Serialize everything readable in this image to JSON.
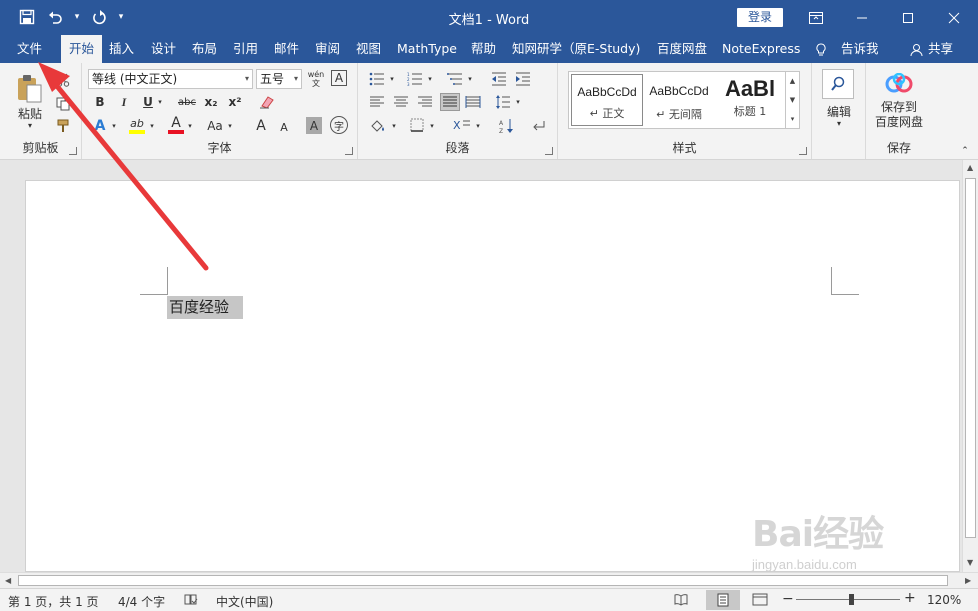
{
  "titlebar": {
    "title": "文档1  -  Word",
    "login_label": "登录",
    "bg_color": "#2b579a"
  },
  "ribbon_tabs": {
    "file": "文件",
    "home": "开始",
    "insert": "插入",
    "design": "设计",
    "layout": "布局",
    "references": "引用",
    "mailings": "邮件",
    "review": "审阅",
    "view": "视图",
    "mathtype": "MathType",
    "help": "帮助",
    "cnki": "知网研学（原E-Study)",
    "baidu_pan": "百度网盘",
    "noteexpress": "NoteExpress",
    "tell_me": "告诉我",
    "share": "共享",
    "active": "开始"
  },
  "clipboard": {
    "paste_label": "粘贴",
    "group_label": "剪贴板"
  },
  "font": {
    "font_name": "等线 (中文正文)",
    "font_size": "五号",
    "wen_glyph": "wén\n文",
    "border_a": "A",
    "bold": "B",
    "italic": "I",
    "underline": "U",
    "strike": "abc",
    "subscript": "x₂",
    "superscript": "x²",
    "text_effect": "A",
    "highlight": "ab",
    "font_color": "A",
    "change_case": "Aa",
    "grow": "A",
    "shrink": "A",
    "shade_a": "A",
    "enclose": "字",
    "group_label": "字体"
  },
  "paragraph": {
    "group_label": "段落"
  },
  "styles": {
    "items": [
      {
        "preview": "AaBbCcDd",
        "name": "↵ 正文"
      },
      {
        "preview": "AaBbCcDd",
        "name": "↵ 无间隔"
      },
      {
        "preview": "AaBl",
        "name": "标题 1"
      }
    ],
    "group_label": "样式"
  },
  "editing": {
    "label": "编辑"
  },
  "save_group": {
    "button_label": "保存到\n百度网盘",
    "group_label": "保存"
  },
  "document": {
    "text": "百度经验"
  },
  "statusbar": {
    "page": "第 1 页，共 1 页",
    "words": "4/4 个字",
    "language": "中文(中国)",
    "zoom": "120%"
  },
  "watermark": {
    "logo": "Bai经验",
    "url": "jingyan.baidu.com"
  },
  "annotation": {
    "arrow_color": "#e8393a"
  }
}
